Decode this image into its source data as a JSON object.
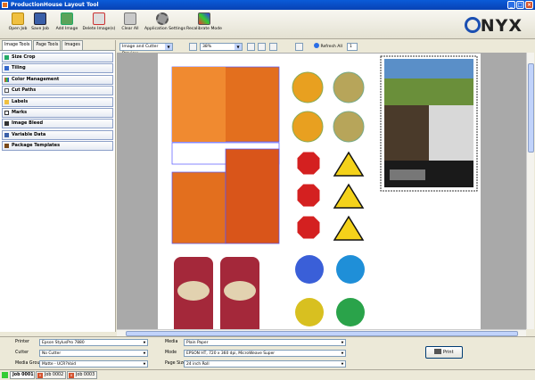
{
  "window": {
    "title": "ProductionHouse Layout Tool"
  },
  "toolbar": {
    "buttons": [
      {
        "label": "Open Job",
        "icon": "folder-icon"
      },
      {
        "label": "Save Job",
        "icon": "floppy-icon"
      },
      {
        "label": "Add Image",
        "icon": "add-image-icon"
      },
      {
        "label": "Delete Image(s)",
        "icon": "delete-image-icon"
      },
      {
        "label": "Clear All",
        "icon": "clear-all-icon"
      },
      {
        "label": "Application Settings",
        "icon": "gear-icon"
      },
      {
        "label": "Recalibrate Mode",
        "icon": "recalibrate-icon"
      }
    ],
    "brand": "NYX"
  },
  "left_tabs": [
    "Image Tools",
    "Page Tools",
    "Images"
  ],
  "tools": [
    "Size Crop",
    "Tiling",
    "Color Management",
    "Cut Paths",
    "Labels",
    "Marks",
    "Image Bleed",
    "Variable Data",
    "Package Templates"
  ],
  "view": {
    "preview_mode": "Image and Cutter Preview",
    "zoom": "38%",
    "refresh": "Refresh All",
    "refresh_count": "1"
  },
  "bottom": {
    "printer_label": "Printer",
    "printer_value": "Epson StylusPro 7880",
    "cutter_label": "Cutter",
    "cutter_value": "No Cutter",
    "media_group_label": "Media Group",
    "media_group_value": "Matte - UCR?Void",
    "media_label": "Media",
    "media_value": "Plain Paper",
    "mode_label": "Mode",
    "mode_value": "EPSON HT, 720 x 360 dpi, MicroWeave Super",
    "page_size_label": "Page Size",
    "page_size_value": "24 inch Roll",
    "print_label": "Print"
  },
  "jobs": [
    "Job 0001",
    "Job 0002",
    "Job 0003"
  ],
  "colors": {
    "title_bar": "#0a5bd8",
    "accent": "#e36f1e",
    "canvas": "#a9a9a9"
  }
}
